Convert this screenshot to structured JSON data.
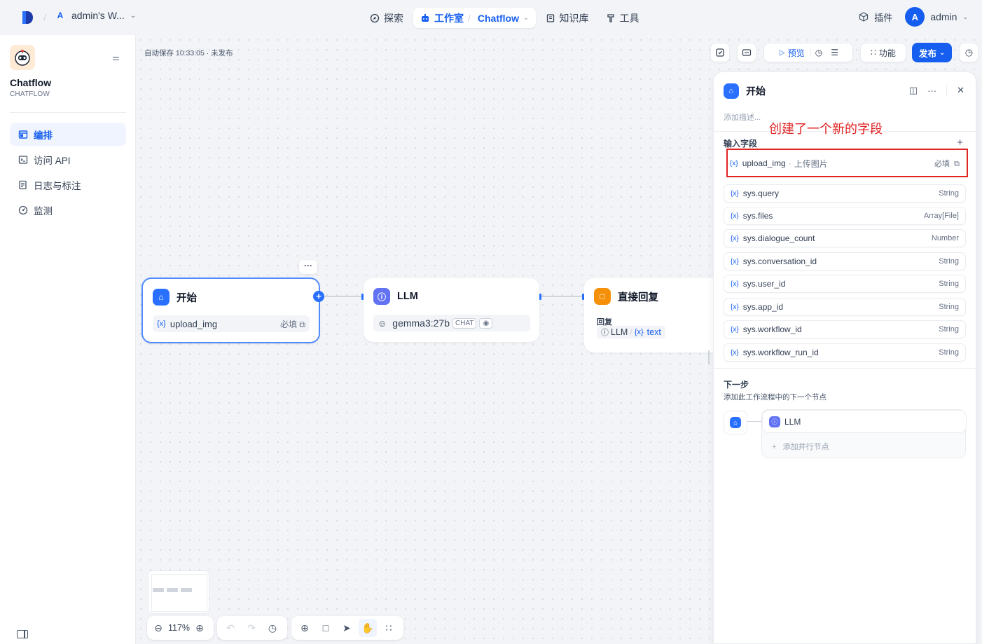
{
  "topbar": {
    "workspace_initial": "A",
    "workspace_name": "admin's W...",
    "nav": [
      {
        "label": "探索"
      },
      {
        "label": "工作室",
        "sub": "Chatflow"
      },
      {
        "label": "知识库"
      },
      {
        "label": "工具"
      }
    ],
    "plugins_label": "插件",
    "user_initial": "A",
    "user_name": "admin"
  },
  "sidebar": {
    "app_name": "Chatflow",
    "app_type": "CHATFLOW",
    "items": [
      {
        "label": "编排",
        "icon": "layout-icon"
      },
      {
        "label": "访问 API",
        "icon": "terminal-icon"
      },
      {
        "label": "日志与标注",
        "icon": "file-list-icon"
      },
      {
        "label": "监测",
        "icon": "monitor-icon"
      }
    ]
  },
  "canvas": {
    "autosave": "自动保存 10:33:05 · 未发布",
    "toolbar": {
      "preview": "预览",
      "features": "功能",
      "publish": "发布"
    },
    "nodes": {
      "start": {
        "title": "开始",
        "var": "upload_img",
        "required": "必填"
      },
      "llm": {
        "title": "LLM",
        "model": "gemma3:27b",
        "mode": "CHAT"
      },
      "answer": {
        "title": "直接回复",
        "section": "回复",
        "ref_node": "LLM",
        "ref_var": "text"
      }
    },
    "zoom": "117%"
  },
  "panel": {
    "title": "开始",
    "desc_placeholder": "添加描述...",
    "input_fields_title": "输入字段",
    "annotation": "创建了一个新的字段",
    "custom_field": {
      "name": "upload_img",
      "label": "上传图片",
      "required": "必填"
    },
    "sys_fields": [
      {
        "name": "sys.query",
        "type": "String"
      },
      {
        "name": "sys.files",
        "type": "Array[File]"
      },
      {
        "name": "sys.dialogue_count",
        "type": "Number"
      },
      {
        "name": "sys.conversation_id",
        "type": "String"
      },
      {
        "name": "sys.user_id",
        "type": "String"
      },
      {
        "name": "sys.app_id",
        "type": "String"
      },
      {
        "name": "sys.workflow_id",
        "type": "String"
      },
      {
        "name": "sys.workflow_run_id",
        "type": "String"
      }
    ],
    "var_icon": "{x}",
    "next_step_title": "下一步",
    "next_step_desc": "添加此工作流程中的下一个节点",
    "next_node": "LLM",
    "add_parallel": "添加并行节点"
  }
}
